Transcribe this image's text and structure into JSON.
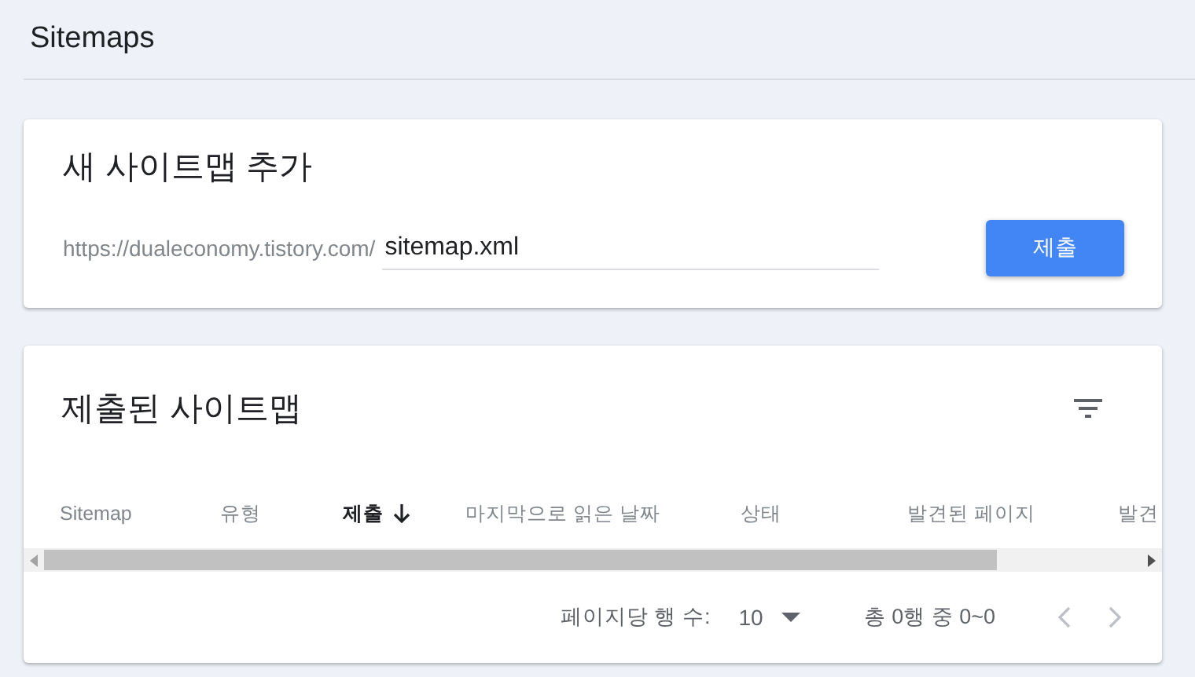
{
  "page_title": "Sitemaps",
  "add_card": {
    "title": "새 사이트맵 추가",
    "url_prefix": "https://dualeconomy.tistory.com/",
    "input": {
      "value": "sitemap.xml"
    },
    "submit_button": "제출"
  },
  "submitted_card": {
    "title": "제출된 사이트맵",
    "table": {
      "columns": [
        {
          "label": "Sitemap",
          "selected": false
        },
        {
          "label": "유형",
          "selected": false
        },
        {
          "label": "제출",
          "selected": true
        },
        {
          "label": "마지막으로 읽은 날짜",
          "selected": false
        },
        {
          "label": "상태",
          "selected": false
        },
        {
          "label": "발견된 페이지",
          "selected": false
        },
        {
          "label": "발견",
          "selected": false
        }
      ]
    },
    "pagination": {
      "rows_per_page_label": "페이지당 행 수:",
      "rows_per_page": "10",
      "range": "총 0행 중 0~0",
      "prev_disabled": true,
      "next_disabled": true
    }
  }
}
